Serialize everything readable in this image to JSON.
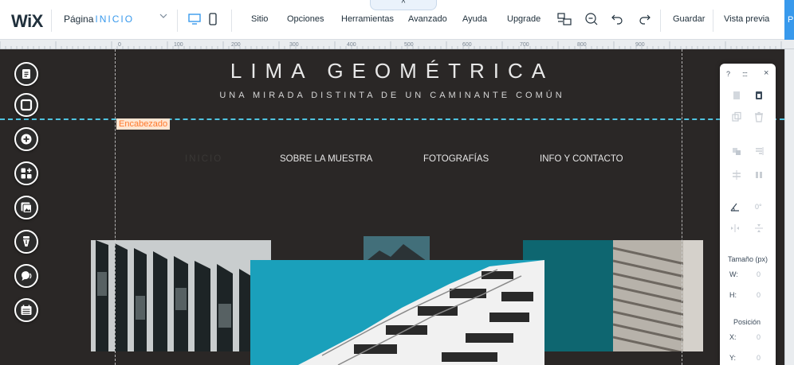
{
  "topbar": {
    "logo": "WiX",
    "page_label": "Página",
    "page_name": "INICIO",
    "menu": [
      "Sitio",
      "Opciones",
      "Herramientas",
      "Avanzado",
      "Ayuda",
      "Upgrade"
    ],
    "collapse_glyph": "^",
    "save": "Guardar",
    "preview": "Vista previa",
    "publish": "P"
  },
  "ruler": {
    "ticks": [
      "0",
      "100",
      "200",
      "300",
      "400",
      "500",
      "600",
      "700",
      "800",
      "900"
    ]
  },
  "canvas": {
    "header_label": "Encabezado",
    "site_title": "LIMA GEOMÉTRICA",
    "site_subtitle": "UNA MIRADA DISTINTA DE UN CAMINANTE COMÚN",
    "nav": [
      "INICIO",
      "SOBRE LA MUESTRA",
      "FOTOGRAFÍAS",
      "INFO Y CONTACTO"
    ]
  },
  "tools": [
    "pages-icon",
    "background-icon",
    "add-icon",
    "apps-icon",
    "media-icon",
    "blog-icon",
    "chat-icon",
    "bookings-icon"
  ],
  "panel": {
    "help": "?",
    "drag": "::::",
    "close": "×",
    "rotation": "0°",
    "size_title": "Tamaño (px)",
    "w_label": "W:",
    "w_value": "0",
    "h_label": "H:",
    "h_value": "0",
    "pos_title": "Posición",
    "x_label": "X:",
    "x_value": "0",
    "y_label": "Y:",
    "y_value": "0"
  },
  "colors": {
    "accent": "#3899ec",
    "canvas_bg": "#2a2726",
    "teal": "#0e6670",
    "sky": "#1a9db8",
    "header_tag": "#ff7a2e"
  }
}
